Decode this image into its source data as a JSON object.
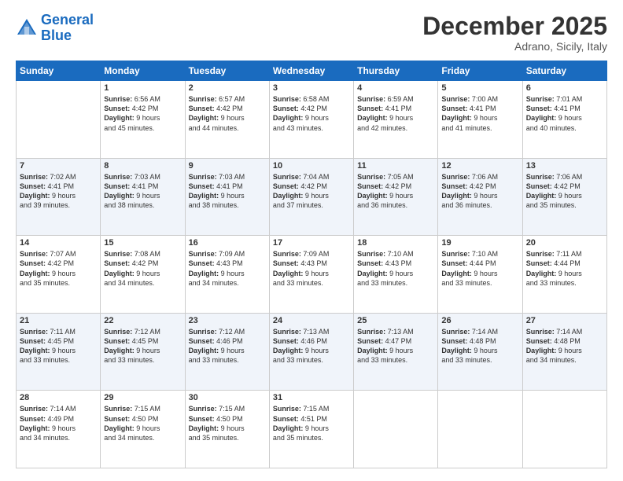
{
  "header": {
    "logo_line1": "General",
    "logo_line2": "Blue",
    "month": "December 2025",
    "location": "Adrano, Sicily, Italy"
  },
  "days_of_week": [
    "Sunday",
    "Monday",
    "Tuesday",
    "Wednesday",
    "Thursday",
    "Friday",
    "Saturday"
  ],
  "weeks": [
    [
      {
        "day": "",
        "info": ""
      },
      {
        "day": "1",
        "info": "Sunrise: 6:56 AM\nSunset: 4:42 PM\nDaylight: 9 hours\nand 45 minutes."
      },
      {
        "day": "2",
        "info": "Sunrise: 6:57 AM\nSunset: 4:42 PM\nDaylight: 9 hours\nand 44 minutes."
      },
      {
        "day": "3",
        "info": "Sunrise: 6:58 AM\nSunset: 4:42 PM\nDaylight: 9 hours\nand 43 minutes."
      },
      {
        "day": "4",
        "info": "Sunrise: 6:59 AM\nSunset: 4:41 PM\nDaylight: 9 hours\nand 42 minutes."
      },
      {
        "day": "5",
        "info": "Sunrise: 7:00 AM\nSunset: 4:41 PM\nDaylight: 9 hours\nand 41 minutes."
      },
      {
        "day": "6",
        "info": "Sunrise: 7:01 AM\nSunset: 4:41 PM\nDaylight: 9 hours\nand 40 minutes."
      }
    ],
    [
      {
        "day": "7",
        "info": "Sunrise: 7:02 AM\nSunset: 4:41 PM\nDaylight: 9 hours\nand 39 minutes."
      },
      {
        "day": "8",
        "info": "Sunrise: 7:03 AM\nSunset: 4:41 PM\nDaylight: 9 hours\nand 38 minutes."
      },
      {
        "day": "9",
        "info": "Sunrise: 7:03 AM\nSunset: 4:41 PM\nDaylight: 9 hours\nand 38 minutes."
      },
      {
        "day": "10",
        "info": "Sunrise: 7:04 AM\nSunset: 4:42 PM\nDaylight: 9 hours\nand 37 minutes."
      },
      {
        "day": "11",
        "info": "Sunrise: 7:05 AM\nSunset: 4:42 PM\nDaylight: 9 hours\nand 36 minutes."
      },
      {
        "day": "12",
        "info": "Sunrise: 7:06 AM\nSunset: 4:42 PM\nDaylight: 9 hours\nand 36 minutes."
      },
      {
        "day": "13",
        "info": "Sunrise: 7:06 AM\nSunset: 4:42 PM\nDaylight: 9 hours\nand 35 minutes."
      }
    ],
    [
      {
        "day": "14",
        "info": "Sunrise: 7:07 AM\nSunset: 4:42 PM\nDaylight: 9 hours\nand 35 minutes."
      },
      {
        "day": "15",
        "info": "Sunrise: 7:08 AM\nSunset: 4:42 PM\nDaylight: 9 hours\nand 34 minutes."
      },
      {
        "day": "16",
        "info": "Sunrise: 7:09 AM\nSunset: 4:43 PM\nDaylight: 9 hours\nand 34 minutes."
      },
      {
        "day": "17",
        "info": "Sunrise: 7:09 AM\nSunset: 4:43 PM\nDaylight: 9 hours\nand 33 minutes."
      },
      {
        "day": "18",
        "info": "Sunrise: 7:10 AM\nSunset: 4:43 PM\nDaylight: 9 hours\nand 33 minutes."
      },
      {
        "day": "19",
        "info": "Sunrise: 7:10 AM\nSunset: 4:44 PM\nDaylight: 9 hours\nand 33 minutes."
      },
      {
        "day": "20",
        "info": "Sunrise: 7:11 AM\nSunset: 4:44 PM\nDaylight: 9 hours\nand 33 minutes."
      }
    ],
    [
      {
        "day": "21",
        "info": "Sunrise: 7:11 AM\nSunset: 4:45 PM\nDaylight: 9 hours\nand 33 minutes."
      },
      {
        "day": "22",
        "info": "Sunrise: 7:12 AM\nSunset: 4:45 PM\nDaylight: 9 hours\nand 33 minutes."
      },
      {
        "day": "23",
        "info": "Sunrise: 7:12 AM\nSunset: 4:46 PM\nDaylight: 9 hours\nand 33 minutes."
      },
      {
        "day": "24",
        "info": "Sunrise: 7:13 AM\nSunset: 4:46 PM\nDaylight: 9 hours\nand 33 minutes."
      },
      {
        "day": "25",
        "info": "Sunrise: 7:13 AM\nSunset: 4:47 PM\nDaylight: 9 hours\nand 33 minutes."
      },
      {
        "day": "26",
        "info": "Sunrise: 7:14 AM\nSunset: 4:48 PM\nDaylight: 9 hours\nand 33 minutes."
      },
      {
        "day": "27",
        "info": "Sunrise: 7:14 AM\nSunset: 4:48 PM\nDaylight: 9 hours\nand 34 minutes."
      }
    ],
    [
      {
        "day": "28",
        "info": "Sunrise: 7:14 AM\nSunset: 4:49 PM\nDaylight: 9 hours\nand 34 minutes."
      },
      {
        "day": "29",
        "info": "Sunrise: 7:15 AM\nSunset: 4:50 PM\nDaylight: 9 hours\nand 34 minutes."
      },
      {
        "day": "30",
        "info": "Sunrise: 7:15 AM\nSunset: 4:50 PM\nDaylight: 9 hours\nand 35 minutes."
      },
      {
        "day": "31",
        "info": "Sunrise: 7:15 AM\nSunset: 4:51 PM\nDaylight: 9 hours\nand 35 minutes."
      },
      {
        "day": "",
        "info": ""
      },
      {
        "day": "",
        "info": ""
      },
      {
        "day": "",
        "info": ""
      }
    ]
  ]
}
